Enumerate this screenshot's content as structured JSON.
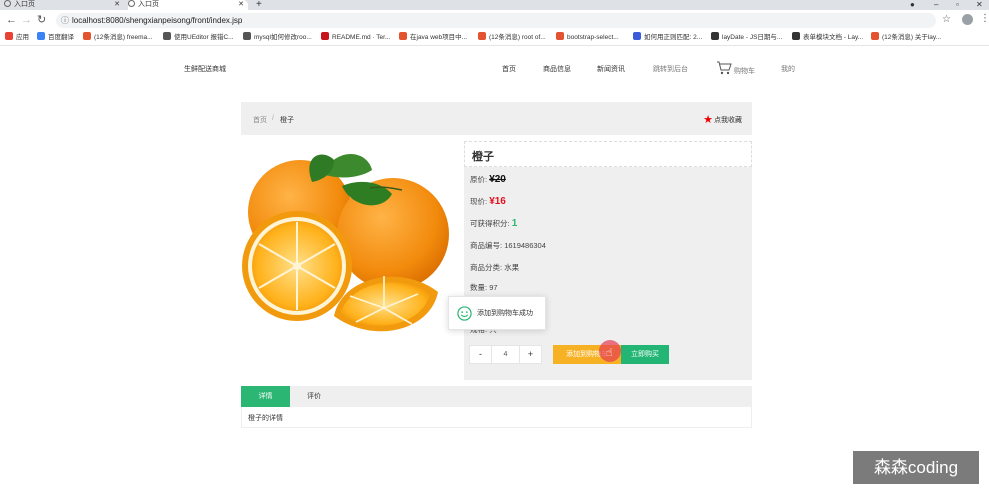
{
  "browser": {
    "tabs": [
      {
        "title": "入口页"
      },
      {
        "title": "入口页"
      }
    ],
    "new_tab": "+",
    "url": "localhost:8080/shengxianpeisong/front/index.jsp",
    "bookmarks": [
      {
        "label": "应用",
        "color": "#e94235"
      },
      {
        "label": "百度翻译",
        "color": "#3b82f6"
      },
      {
        "label": "(12条消息) freema...",
        "color": "#e4532f"
      },
      {
        "label": "使用UEditor 报错C...",
        "color": "#555555"
      },
      {
        "label": "mysql如何修改roo...",
        "color": "#555555"
      },
      {
        "label": "README.md · Ter...",
        "color": "#c7151b"
      },
      {
        "label": "在java web项目中...",
        "color": "#e4532f"
      },
      {
        "label": "(12条消息) root of...",
        "color": "#e4532f"
      },
      {
        "label": "bootstrap-select...",
        "color": "#e4532f"
      },
      {
        "label": "如何用正则匹配: 2...",
        "color": "#3b5bdb"
      },
      {
        "label": "layDate - JS日期与...",
        "color": "#333333"
      },
      {
        "label": "表单模块文档 - Lay...",
        "color": "#333333"
      },
      {
        "label": "(12条消息) 关于lay...",
        "color": "#e4532f"
      }
    ]
  },
  "site": {
    "name": "生鲜配送商城",
    "nav": [
      {
        "label": "首页"
      },
      {
        "label": "商品信息"
      },
      {
        "label": "新闻资讯"
      },
      {
        "label": "跳转到后台"
      },
      {
        "label": "购物车"
      },
      {
        "label": "我的"
      }
    ]
  },
  "breadcrumb": {
    "home": "首页",
    "sep": "/",
    "current": "橙子"
  },
  "favorite": "点我收藏",
  "product": {
    "name": "橙子",
    "original_price_label": "原价:",
    "original_price": "¥20",
    "current_price_label": "现价:",
    "current_price": "¥16",
    "points_label": "可获得积分:",
    "points": "1",
    "code_label": "商品编号:",
    "code": "1619486304",
    "category_label": "商品分类:",
    "category": "水果",
    "stock_label": "数量:",
    "stock": "97",
    "partial_label": "规格:",
    "partial_value": "只",
    "quantity": "4",
    "minus": "-",
    "plus": "+",
    "add_to_cart": "添加到购物车",
    "buy_now": "立即购买"
  },
  "toast": "添加到购物车成功",
  "detail_tabs": [
    {
      "label": "详情",
      "active": true
    },
    {
      "label": "评价",
      "active": false
    }
  ],
  "detail_body": "橙子的详情",
  "watermark": "森森coding",
  "colors": {
    "accent": "#2bb673",
    "price": "#e3101d",
    "cart_button": "#f7b124"
  }
}
